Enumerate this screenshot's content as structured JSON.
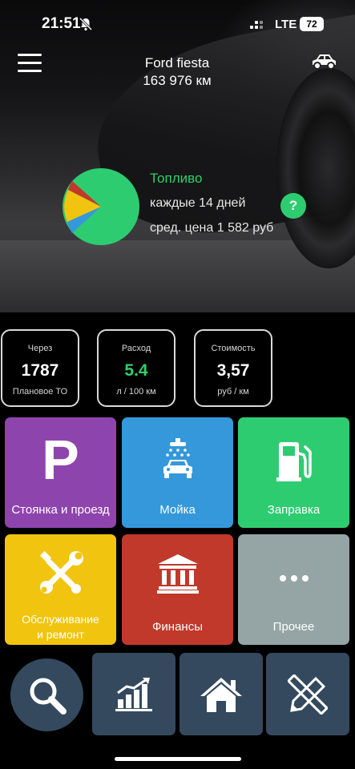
{
  "status_bar": {
    "time": "21:51",
    "network": "LTE",
    "battery": "72"
  },
  "header": {
    "car_name": "Ford fiesta",
    "mileage": "163 976 км"
  },
  "summary": {
    "title": "Топливо",
    "frequency": "каждые 14 дней",
    "avg_price": "сред. цена 1 582 руб",
    "help_label": "?",
    "pie_colors": [
      "#2ecc71",
      "#f1c40f",
      "#c0392b",
      "#3498db"
    ]
  },
  "stats": [
    {
      "label": "Через",
      "value": "1787",
      "sub": "Плановое ТО"
    },
    {
      "label": "Расход",
      "value": "5.4",
      "sub": "л / 100 км",
      "value_color": "#2fd06a"
    },
    {
      "label": "Стоимость",
      "value": "3,57",
      "sub": "руб / км"
    }
  ],
  "tiles": [
    {
      "label": "Стоянка и проезд",
      "icon": "parking-icon",
      "color": "#8e44ad"
    },
    {
      "label": "Мойка",
      "icon": "car-wash-icon",
      "color": "#3498db"
    },
    {
      "label": "Заправка",
      "icon": "fuel-pump-icon",
      "color": "#2ecc71"
    },
    {
      "label_line1": "Обслуживание",
      "label_line2": "и ремонт",
      "icon": "tools-icon",
      "color": "#f1c40f"
    },
    {
      "label": "Финансы",
      "icon": "bank-icon",
      "color": "#c0392b"
    },
    {
      "label": "Прочее",
      "icon": "more-icon",
      "color": "#95a5a6"
    }
  ],
  "bottom_nav": [
    {
      "icon": "search-icon"
    },
    {
      "icon": "statistics-icon"
    },
    {
      "icon": "home-icon"
    },
    {
      "icon": "tools-ruler-icon"
    }
  ]
}
